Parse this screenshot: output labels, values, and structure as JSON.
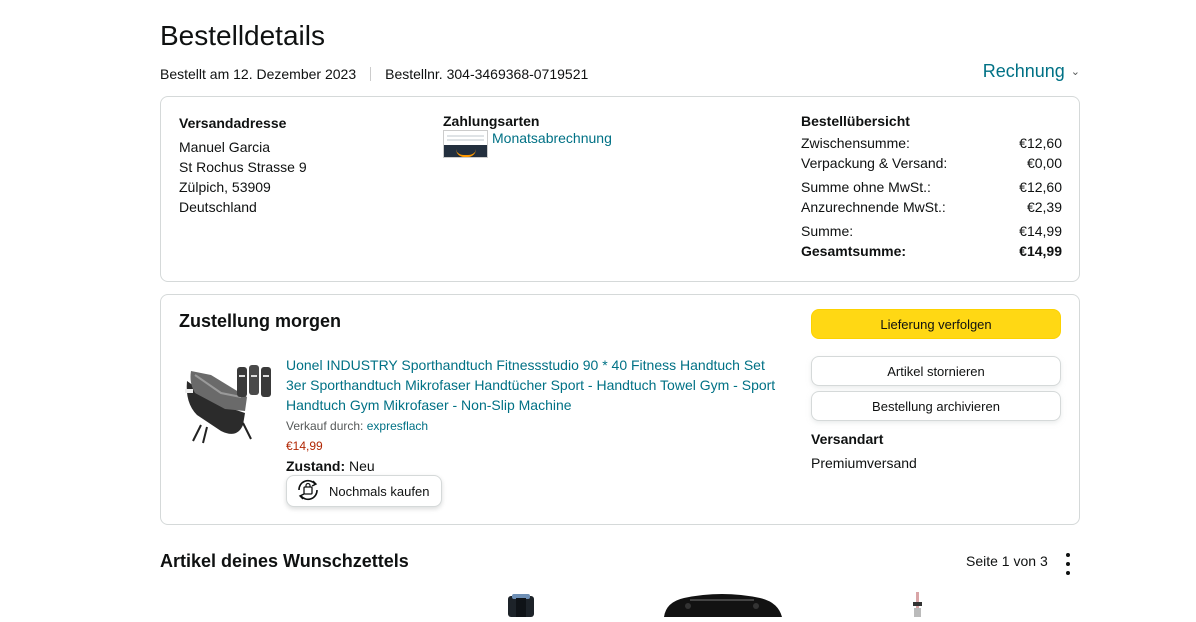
{
  "page": {
    "title": "Bestelldetails",
    "order_date": "Bestellt am 12. Dezember 2023",
    "order_number": "Bestellnr. 304-3469368-0719521",
    "invoice_label": "Rechnung"
  },
  "shipping_address": {
    "heading": "Versandadresse",
    "lines": [
      "Manuel Garcia",
      "St Rochus Strasse 9",
      "Zülpich, 53909",
      "Deutschland"
    ]
  },
  "payment": {
    "heading": "Zahlungsarten",
    "method": "Monatsabrechnung"
  },
  "summary": {
    "heading": "Bestellübersicht",
    "rows": [
      {
        "label": "Zwischensumme:",
        "value": "€12,60"
      },
      {
        "label": "Verpackung & Versand:",
        "value": "€0,00"
      },
      {
        "label": "Summe ohne MwSt.:",
        "value": "€12,60"
      },
      {
        "label": "Anzurechnende MwSt.:",
        "value": "€2,39"
      },
      {
        "label": "Summe:",
        "value": "€14,99"
      },
      {
        "label": "Gesamtsumme:",
        "value": "€14,99"
      }
    ]
  },
  "shipment": {
    "status": "Zustellung morgen",
    "product": {
      "title": "Uonel INDUSTRY Sporthandtuch Fitnessstudio 90 * 40 Fitness Handtuch Set 3er Sporthandtuch Mikrofaser Handtücher Sport - Handtuch Towel Gym - Sport Handtuch Gym Mikrofaser - Non-Slip Machine",
      "seller_label": "Verkauf durch:",
      "seller": "expresflach",
      "price": "€14,99",
      "condition_label": "Zustand:",
      "condition": "Neu",
      "buy_again": "Nochmals kaufen",
      "image_icon": "towel-set-product-image"
    },
    "buttons": {
      "track": "Lieferung verfolgen",
      "cancel": "Artikel stornieren",
      "archive": "Bestellung archivieren"
    },
    "shipping_type_label": "Versandart",
    "shipping_type": "Premiumversand"
  },
  "wishlist": {
    "title": "Artikel deines Wunschzettels",
    "pager": "Seite 1 von 3"
  },
  "colors": {
    "link": "#007185",
    "button_primary": "#FFD814",
    "price": "#B12704",
    "border": "#D5D9D9"
  }
}
